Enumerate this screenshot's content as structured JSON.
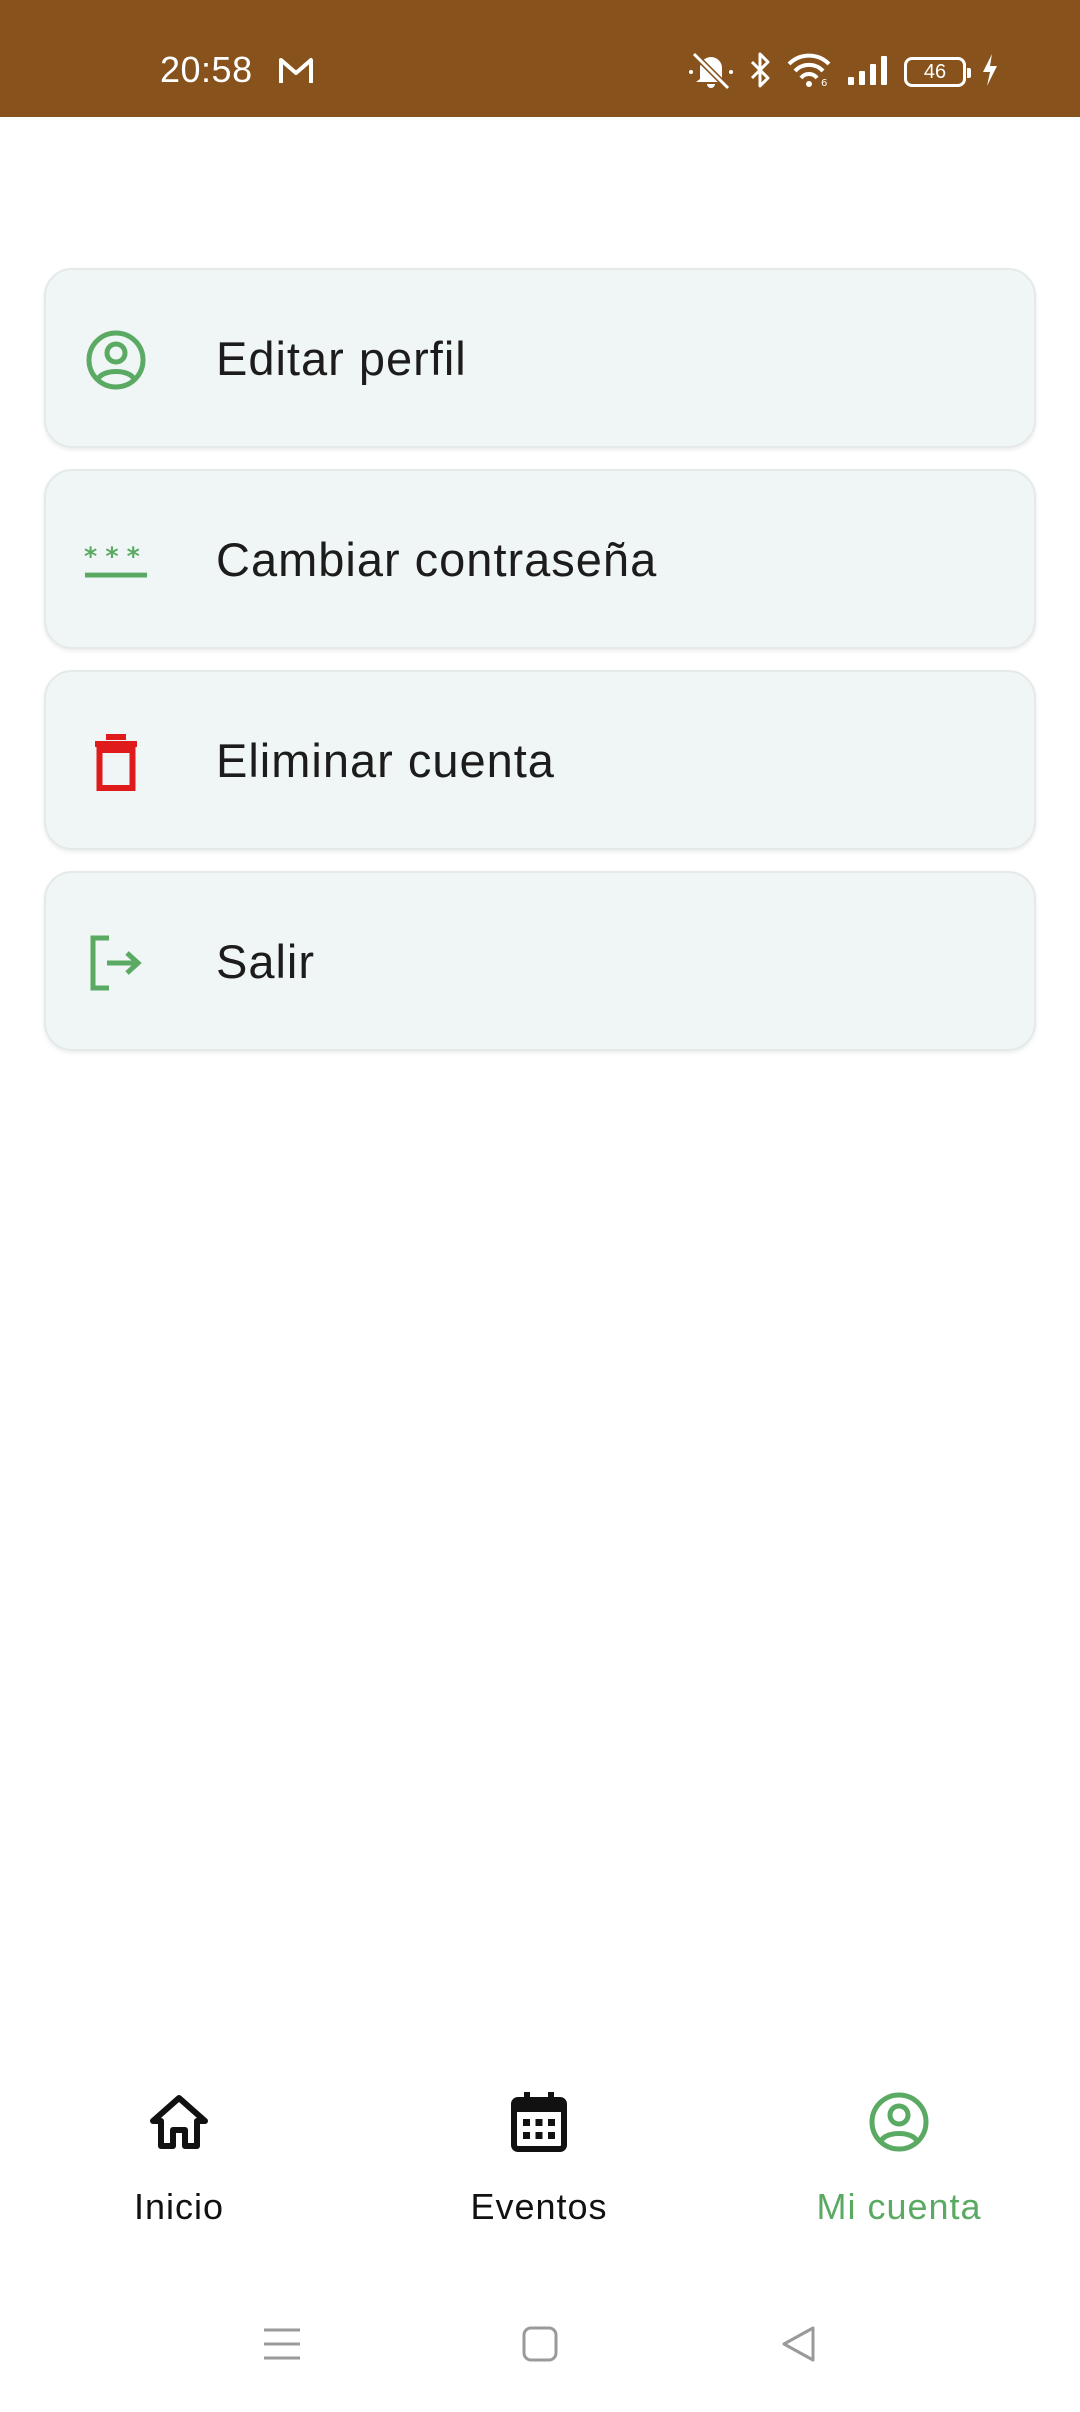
{
  "status_bar": {
    "time": "20:58",
    "battery_level": "46",
    "icons": [
      "gmail-icon",
      "mute-icon",
      "bluetooth-icon",
      "wifi-icon",
      "signal-icon",
      "battery-icon",
      "charging-icon"
    ],
    "background_color": "#87521c"
  },
  "menu": {
    "items": [
      {
        "label": "Editar perfil",
        "icon": "account-circle-icon",
        "icon_color": "#5aaa63"
      },
      {
        "label": "Cambiar contraseña",
        "icon": "password-icon",
        "icon_color": "#5aaa63"
      },
      {
        "label": "Eliminar cuenta",
        "icon": "trash-icon",
        "icon_color": "#e01b1b"
      },
      {
        "label": "Salir",
        "icon": "logout-icon",
        "icon_color": "#5aaa63"
      }
    ]
  },
  "bottom_nav": {
    "items": [
      {
        "label": "Inicio",
        "icon": "home-icon",
        "active": false
      },
      {
        "label": "Eventos",
        "icon": "calendar-icon",
        "active": false
      },
      {
        "label": "Mi cuenta",
        "icon": "account-circle-icon",
        "active": true
      }
    ],
    "active_color": "#5aaa63"
  },
  "system_nav": {
    "buttons": [
      "menu-icon",
      "home-square-icon",
      "back-triangle-icon"
    ]
  }
}
